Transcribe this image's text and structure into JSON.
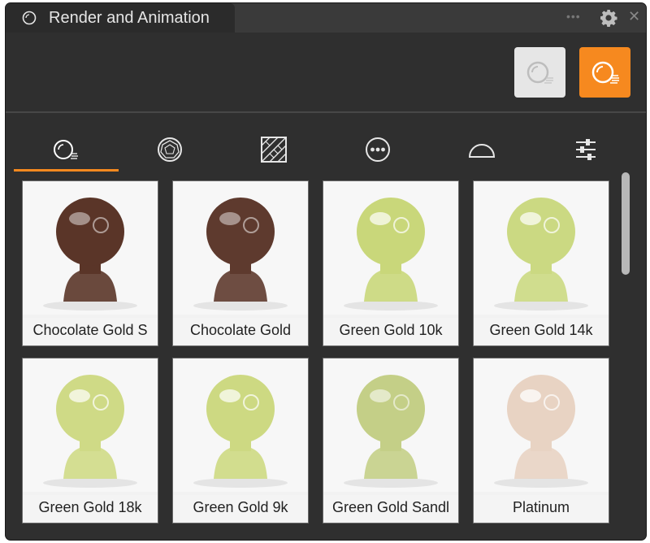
{
  "window": {
    "title": "Render and Animation"
  },
  "toolbar": {
    "still_render_icon": "sphere-still-icon",
    "animation_render_icon": "sphere-animation-icon",
    "accent": "#f6891f"
  },
  "tabs": [
    {
      "icon": "material-sphere-icon",
      "active": true
    },
    {
      "icon": "gem-icon",
      "active": false
    },
    {
      "icon": "texture-pattern-icon",
      "active": false
    },
    {
      "icon": "more-circle-icon",
      "active": false
    },
    {
      "icon": "dome-icon",
      "active": false
    },
    {
      "icon": "sliders-icon",
      "active": false
    }
  ],
  "materials": [
    {
      "label": "Chocolate Gold S",
      "tint": "#5a3528"
    },
    {
      "label": "Chocolate Gold",
      "tint": "#5e3a2e"
    },
    {
      "label": "Green Gold 10k",
      "tint": "#c9d77a"
    },
    {
      "label": "Green Gold 14k",
      "tint": "#cbd982"
    },
    {
      "label": "Green Gold 18k",
      "tint": "#cfda86"
    },
    {
      "label": "Green Gold 9k",
      "tint": "#cdd982"
    },
    {
      "label": "Green Gold Sandl",
      "tint": "#c4cf87"
    },
    {
      "label": "Platinum",
      "tint": "#e8d3c3"
    }
  ]
}
